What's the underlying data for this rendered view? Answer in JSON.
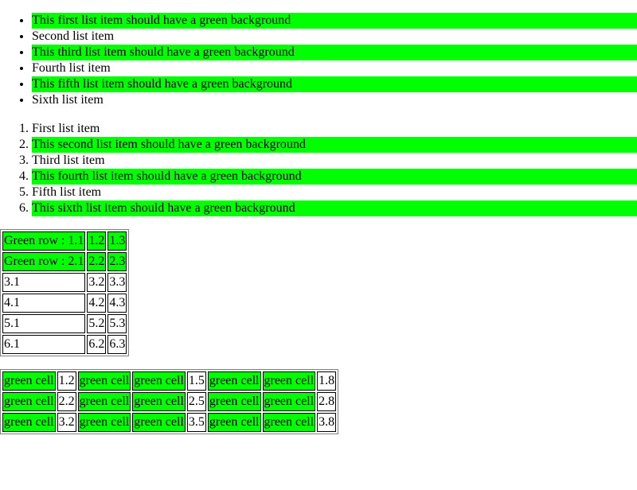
{
  "colors": {
    "highlight": "#00ff00",
    "page_background": "#ffffff",
    "text": "#000000"
  },
  "unordered_list": {
    "items": [
      {
        "label": "This first list item should have a green background",
        "green": true
      },
      {
        "label": "Second list item",
        "green": false
      },
      {
        "label": "This third list item should have a green background",
        "green": true
      },
      {
        "label": "Fourth list item",
        "green": false
      },
      {
        "label": "This fifth list item should have a green background",
        "green": true
      },
      {
        "label": "Sixth list item",
        "green": false
      }
    ]
  },
  "ordered_list": {
    "items": [
      {
        "label": "First list item",
        "green": false
      },
      {
        "label": "This second list item should have a green background",
        "green": true
      },
      {
        "label": "Third list item",
        "green": false
      },
      {
        "label": "This fourth list item should have a green background",
        "green": true
      },
      {
        "label": "Fifth list item",
        "green": false
      },
      {
        "label": "This sixth list item should have a green background",
        "green": true
      }
    ]
  },
  "row_table": {
    "rows": [
      {
        "green": true,
        "cells": [
          "Green row : 1.1",
          "1.2",
          "1.3"
        ]
      },
      {
        "green": true,
        "cells": [
          "Green row : 2.1",
          "2.2",
          "2.3"
        ]
      },
      {
        "green": false,
        "cells": [
          "3.1",
          "3.2",
          "3.3"
        ]
      },
      {
        "green": false,
        "cells": [
          "4.1",
          "4.2",
          "4.3"
        ]
      },
      {
        "green": false,
        "cells": [
          "5.1",
          "5.2",
          "5.3"
        ]
      },
      {
        "green": false,
        "cells": [
          "6.1",
          "6.2",
          "6.3"
        ]
      }
    ]
  },
  "cell_table": {
    "rows": [
      [
        {
          "text": "green cell",
          "green": true
        },
        {
          "text": "1.2",
          "green": false
        },
        {
          "text": "green cell",
          "green": true
        },
        {
          "text": "green cell",
          "green": true
        },
        {
          "text": "1.5",
          "green": false
        },
        {
          "text": "green cell",
          "green": true
        },
        {
          "text": "green cell",
          "green": true
        },
        {
          "text": "1.8",
          "green": false
        }
      ],
      [
        {
          "text": "green cell",
          "green": true
        },
        {
          "text": "2.2",
          "green": false
        },
        {
          "text": "green cell",
          "green": true
        },
        {
          "text": "green cell",
          "green": true
        },
        {
          "text": "2.5",
          "green": false
        },
        {
          "text": "green cell",
          "green": true
        },
        {
          "text": "green cell",
          "green": true
        },
        {
          "text": "2.8",
          "green": false
        }
      ],
      [
        {
          "text": "green cell",
          "green": true
        },
        {
          "text": "3.2",
          "green": false
        },
        {
          "text": "green cell",
          "green": true
        },
        {
          "text": "green cell",
          "green": true
        },
        {
          "text": "3.5",
          "green": false
        },
        {
          "text": "green cell",
          "green": true
        },
        {
          "text": "green cell",
          "green": true
        },
        {
          "text": "3.8",
          "green": false
        }
      ]
    ]
  }
}
